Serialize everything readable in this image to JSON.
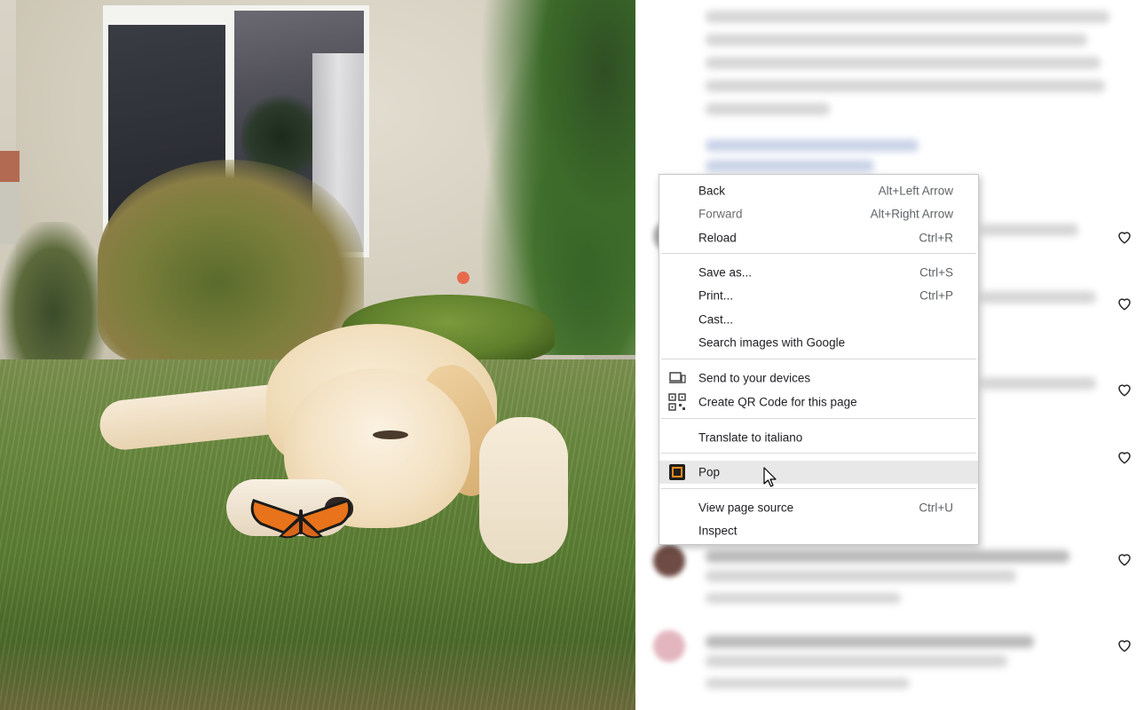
{
  "context_menu": {
    "items": [
      {
        "label": "Back",
        "shortcut": "Alt+Left Arrow"
      },
      {
        "label": "Forward",
        "shortcut": "Alt+Right Arrow"
      },
      {
        "label": "Reload",
        "shortcut": "Ctrl+R"
      },
      {
        "label": "Save as...",
        "shortcut": "Ctrl+S"
      },
      {
        "label": "Print...",
        "shortcut": "Ctrl+P"
      },
      {
        "label": "Cast..."
      },
      {
        "label": "Search images with Google"
      },
      {
        "label": "Send to your devices",
        "icon": "devices-icon"
      },
      {
        "label": "Create QR Code for this page",
        "icon": "qr-code-icon"
      },
      {
        "label": "Translate to italiano"
      },
      {
        "label": "Pop",
        "icon": "pop-extension-icon"
      },
      {
        "label": "View page source",
        "shortcut": "Ctrl+U"
      },
      {
        "label": "Inspect"
      }
    ]
  },
  "colors": {
    "menu_background": "#ffffff",
    "menu_hover": "#e8e8e8",
    "menu_text": "#202124",
    "heart_outline": "#262626"
  }
}
